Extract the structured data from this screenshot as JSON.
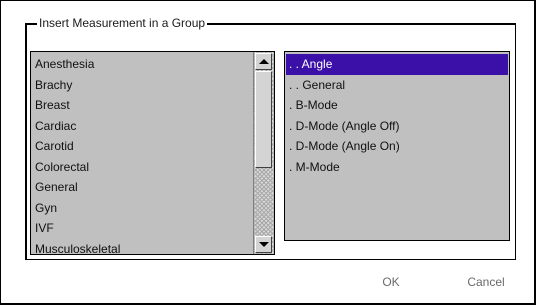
{
  "group": {
    "title": "Insert Measurement in a Group"
  },
  "groups_list": {
    "items": [
      "Anesthesia",
      "Brachy",
      "Breast",
      "Cardiac",
      "Carotid",
      "Colorectal",
      "General",
      "Gyn",
      "IVF",
      "Musculoskeletal"
    ]
  },
  "measurements_list": {
    "items": [
      ". . Angle",
      ". . General",
      ". B-Mode",
      ". D-Mode (Angle Off)",
      ". D-Mode (Angle On)",
      ". M-Mode"
    ],
    "selected": ". . Angle"
  },
  "buttons": {
    "ok_label": "OK",
    "cancel_label": "Cancel"
  },
  "colors": {
    "list_background": "#c0c0c0",
    "selection": "#3b10a8",
    "disabled_text": "#6a6a6a"
  },
  "icons": {
    "scroll_up": "scroll-up-arrow-icon",
    "scroll_down": "scroll-down-arrow-icon"
  }
}
